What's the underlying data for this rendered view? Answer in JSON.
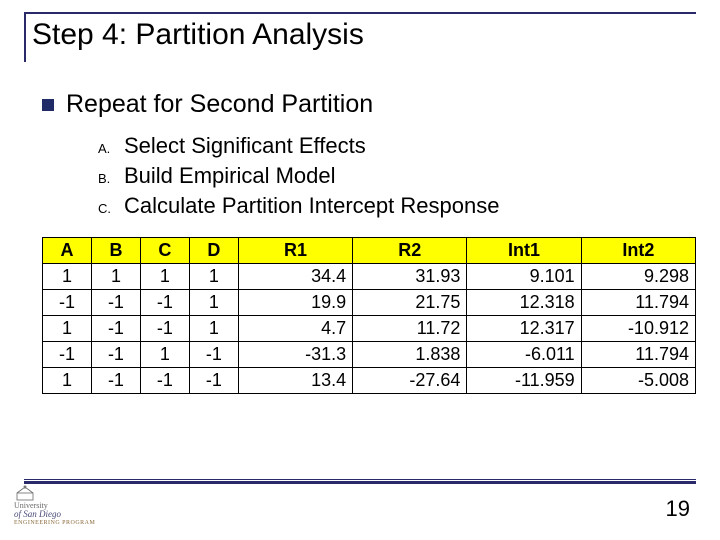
{
  "title": "Step 4: Partition Analysis",
  "bullet": "Repeat for Second Partition",
  "sub": {
    "a": {
      "marker": "A.",
      "text": "Select Significant Effects"
    },
    "b": {
      "marker": "B.",
      "text": "Build Empirical Model"
    },
    "c": {
      "marker": "C.",
      "text": "Calculate Partition Intercept Response"
    }
  },
  "chart_data": {
    "type": "table",
    "headers": [
      "A",
      "B",
      "C",
      "D",
      "R1",
      "R2",
      "Int1",
      "Int2"
    ],
    "col_widths_pct": [
      7.5,
      7.5,
      7.5,
      7.5,
      17.5,
      17.5,
      17.5,
      17.5
    ],
    "rows": [
      {
        "A": 1,
        "B": 1,
        "C": 1,
        "D": 1,
        "R1": "34.4",
        "R2": "31.93",
        "Int1": "9.101",
        "Int2": "9.298"
      },
      {
        "A": -1,
        "B": -1,
        "C": -1,
        "D": 1,
        "R1": "19.9",
        "R2": "21.75",
        "Int1": "12.318",
        "Int2": "11.794"
      },
      {
        "A": 1,
        "B": -1,
        "C": -1,
        "D": 1,
        "R1": "4.7",
        "R2": "11.72",
        "Int1": "12.317",
        "Int2": "-10.912"
      },
      {
        "A": -1,
        "B": -1,
        "C": 1,
        "D": -1,
        "R1": "-31.3",
        "R2": "1.838",
        "Int1": "-6.011",
        "Int2": "11.794"
      },
      {
        "A": 1,
        "B": -1,
        "C": -1,
        "D": -1,
        "R1": "13.4",
        "R2": "-27.64",
        "Int1": "-11.959",
        "Int2": "-5.008"
      }
    ]
  },
  "page_number": "19",
  "logo": {
    "l1": "University",
    "l2": "of San Diego",
    "l3": "ENGINEERING PROGRAM"
  }
}
